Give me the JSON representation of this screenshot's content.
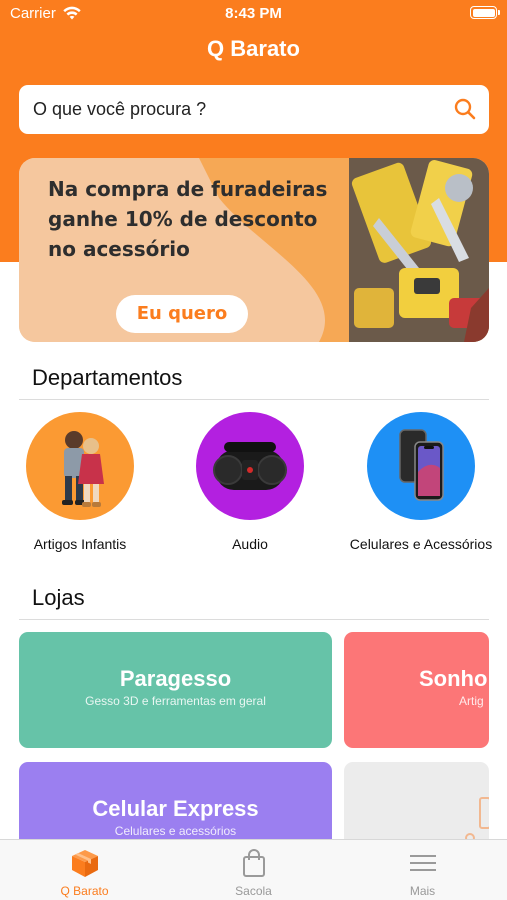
{
  "status_bar": {
    "carrier": "Carrier",
    "time": "8:43 PM"
  },
  "header": {
    "title": "Q Barato"
  },
  "search": {
    "placeholder": "O que você procura ?"
  },
  "promo": {
    "text": "Na compra de furadeiras ganhe 10% de desconto no acessório",
    "button": "Eu quero"
  },
  "departments": {
    "title": "Departamentos",
    "items": [
      {
        "label": "Artigos Infantis",
        "color": "#fb9a33"
      },
      {
        "label": "Audio",
        "color": "#b320e0"
      },
      {
        "label": "Celulares e Acessórios",
        "color": "#1e90f5"
      }
    ]
  },
  "stores": {
    "title": "Lojas",
    "items": [
      {
        "name": "Paragesso",
        "desc": "Gesso 3D e ferramentas em geral",
        "color": "#66c3a8"
      },
      {
        "name": "Sonho",
        "desc": "Artig",
        "color": "#fc7677"
      },
      {
        "name": "Celular Express",
        "desc": "Celulares e acessórios",
        "color": "#9b7ff0"
      },
      {
        "name": "",
        "desc": "",
        "color": "#ececec"
      }
    ]
  },
  "tabbar": {
    "tabs": [
      {
        "label": "Q Barato",
        "icon": "box-icon",
        "active": true
      },
      {
        "label": "Sacola",
        "icon": "bag-icon",
        "active": false
      },
      {
        "label": "Mais",
        "icon": "menu-icon",
        "active": false
      }
    ]
  },
  "colors": {
    "brand": "#fb7d1e"
  }
}
